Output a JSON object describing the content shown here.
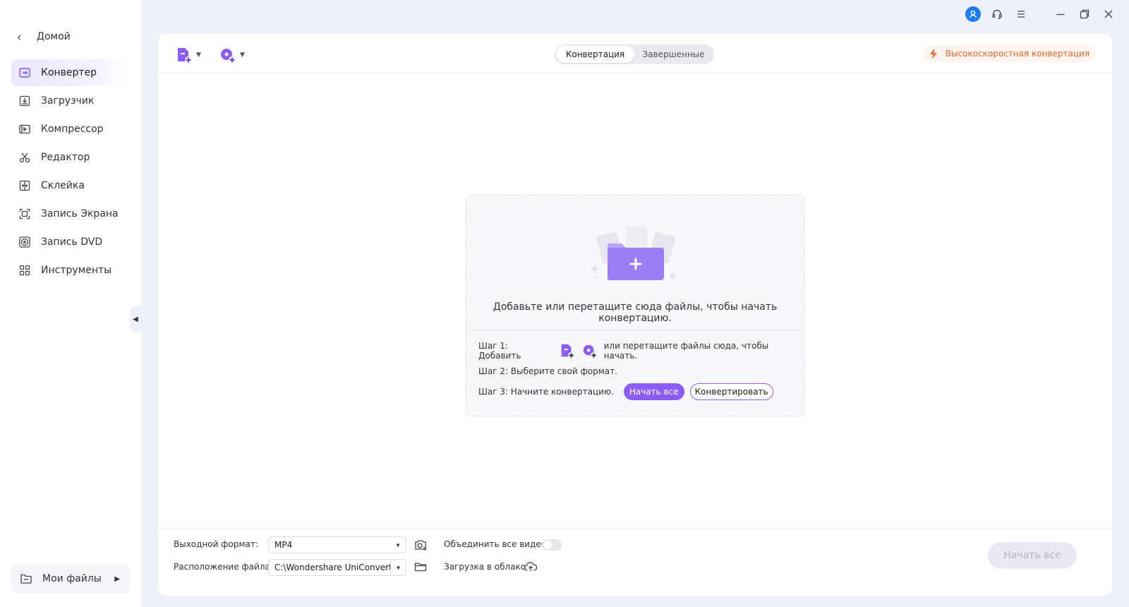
{
  "sidebar": {
    "home_label": "Домой",
    "items": [
      {
        "label": "Конвертер",
        "icon": "converter-icon",
        "active": true
      },
      {
        "label": "Загрузчик",
        "icon": "downloader-icon"
      },
      {
        "label": "Компрессор",
        "icon": "compressor-icon"
      },
      {
        "label": "Редактор",
        "icon": "scissors-icon"
      },
      {
        "label": "Склейка",
        "icon": "merger-icon"
      },
      {
        "label": "Запись Экрана",
        "icon": "screen-record-icon"
      },
      {
        "label": "Запись DVD",
        "icon": "dvd-icon"
      },
      {
        "label": "Инструменты",
        "icon": "tools-grid-icon"
      }
    ],
    "my_files_label": "Мои файлы"
  },
  "topbar": {
    "tabs": [
      {
        "label": "Конвертация",
        "active": true
      },
      {
        "label": "Завершенные",
        "active": false
      }
    ],
    "high_speed_label": "Высокоскоростная конвертация"
  },
  "dropzone": {
    "main_text": "Добавьте или перетащите сюда файлы, чтобы начать конвертацию.",
    "step1_prefix": "Шаг 1: Добавить",
    "step1_suffix": "или перетащите файлы сюда, чтобы начать.",
    "step2": "Шаг 2: Выберите свой формат.",
    "step3": "Шаг 3: Начните конвертацию.",
    "start_all_label": "Начать все",
    "convert_label": "Конвертировать"
  },
  "bottombar": {
    "output_format_label": "Выходной формат:",
    "output_format_value": "MP4",
    "file_location_label": "Расположение файла:",
    "file_location_value": "C:\\Wondershare UniConverter",
    "merge_label": "Объединить все видео",
    "cloud_label": "Загрузка в облако",
    "start_all_label": "Начать все",
    "merge_enabled": false
  },
  "colors": {
    "accent": "#8b5cf6",
    "high_speed": "#f0692c",
    "avatar": "#1e7cf2"
  }
}
